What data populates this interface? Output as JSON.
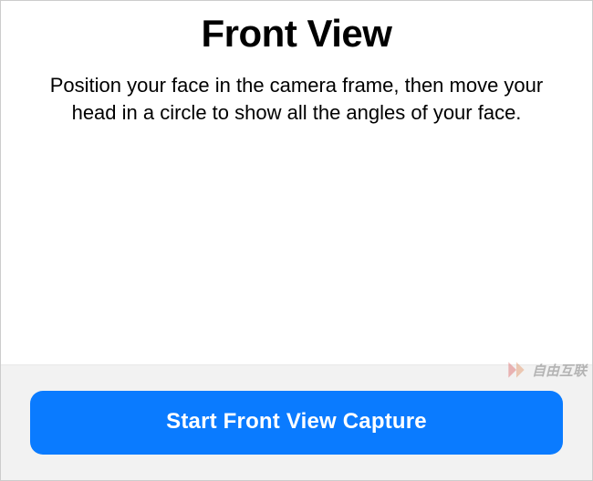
{
  "header": {
    "title": "Front View"
  },
  "main": {
    "description": "Position your face in the camera frame, then move your head in a circle to show all the angles of your face."
  },
  "footer": {
    "capture_button_label": "Start Front View Capture"
  },
  "watermark": {
    "text": "自由互联"
  },
  "colors": {
    "button_bg": "#0a7bff",
    "footer_bg": "#f2f2f2"
  }
}
